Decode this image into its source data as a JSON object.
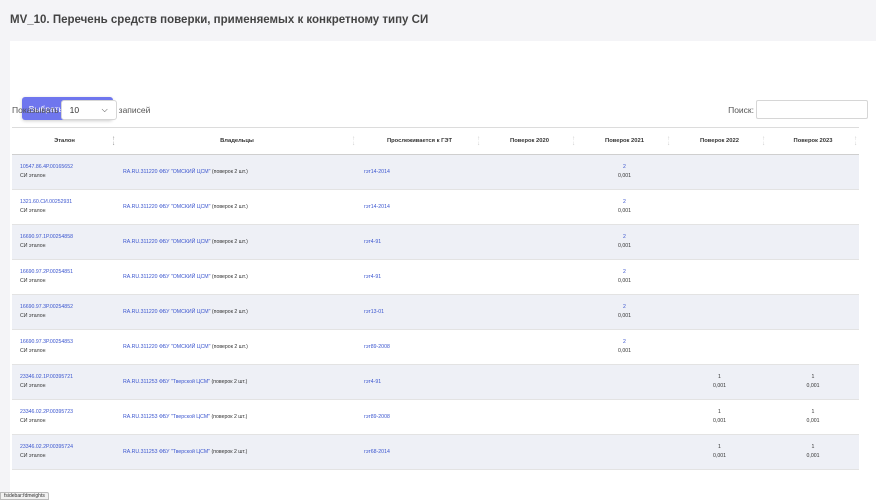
{
  "page": {
    "title": "MV_10. Перечень средств поверки, применяемых к конкретному типу СИ"
  },
  "toolbar": {
    "choose_label": "Выбрать другое СИ"
  },
  "length": {
    "prefix": "Показывать",
    "value": "10",
    "suffix": "записей"
  },
  "search": {
    "label": "Поиск:",
    "value": ""
  },
  "table": {
    "columns": [
      "Эталон",
      "Владельцы",
      "Прослеживается к ГЭТ",
      "Поверок 2020",
      "Поверок 2021",
      "Поверок 2022",
      "Поверок 2023"
    ],
    "rows": [
      {
        "etalon": "10547.86.4Р.00165652",
        "etalon_type": "СИ эталон",
        "owner_link": "RA.RU.311220 ФБУ \"ОМСКИЙ ЦСМ\"",
        "owner_count": "(поверок 2 шт.)",
        "get": "гэт14-2014",
        "p2020": "",
        "p2020b": "",
        "p2021": "2",
        "p2021b": "0,001",
        "p2022": "",
        "p2022b": "",
        "p2023": "",
        "p2023b": ""
      },
      {
        "etalon": "1321.60.СИ.00252931",
        "etalon_type": "СИ эталон",
        "owner_link": "RA.RU.311220 ФБУ \"ОМСКИЙ ЦСМ\"",
        "owner_count": "(поверок 2 шт.)",
        "get": "гэт14-2014",
        "p2020": "",
        "p2020b": "",
        "p2021": "2",
        "p2021b": "0,001",
        "p2022": "",
        "p2022b": "",
        "p2023": "",
        "p2023b": ""
      },
      {
        "etalon": "16690.97.1Р.00254858",
        "etalon_type": "СИ эталон",
        "owner_link": "RA.RU.311220 ФБУ \"ОМСКИЙ ЦСМ\"",
        "owner_count": "(поверок 2 шт.)",
        "get": "гэт4-91",
        "p2020": "",
        "p2020b": "",
        "p2021": "2",
        "p2021b": "0,001",
        "p2022": "",
        "p2022b": "",
        "p2023": "",
        "p2023b": ""
      },
      {
        "etalon": "16690.97.2Р.00254851",
        "etalon_type": "СИ эталон",
        "owner_link": "RA.RU.311220 ФБУ \"ОМСКИЙ ЦСМ\"",
        "owner_count": "(поверок 2 шт.)",
        "get": "гэт4-91",
        "p2020": "",
        "p2020b": "",
        "p2021": "2",
        "p2021b": "0,001",
        "p2022": "",
        "p2022b": "",
        "p2023": "",
        "p2023b": ""
      },
      {
        "etalon": "16690.97.3Р.00254852",
        "etalon_type": "СИ эталон",
        "owner_link": "RA.RU.311220 ФБУ \"ОМСКИЙ ЦСМ\"",
        "owner_count": "(поверок 2 шт.)",
        "get": "гэт13-01",
        "p2020": "",
        "p2020b": "",
        "p2021": "2",
        "p2021b": "0,001",
        "p2022": "",
        "p2022b": "",
        "p2023": "",
        "p2023b": ""
      },
      {
        "etalon": "16690.97.3Р.00254853",
        "etalon_type": "СИ эталон",
        "owner_link": "RA.RU.311220 ФБУ \"ОМСКИЙ ЦСМ\"",
        "owner_count": "(поверок 2 шт.)",
        "get": "гэт89-2008",
        "p2020": "",
        "p2020b": "",
        "p2021": "2",
        "p2021b": "0,001",
        "p2022": "",
        "p2022b": "",
        "p2023": "",
        "p2023b": ""
      },
      {
        "etalon": "23346.02.1Р.00395721",
        "etalon_type": "СИ эталон",
        "owner_link": "RA.RU.311253 ФБУ \"Тверской ЦСМ\"",
        "owner_count": "(поверок 2 шт.)",
        "get": "гэт4-91",
        "p2020": "",
        "p2020b": "",
        "p2021": "",
        "p2021b": "",
        "p2022": "1",
        "p2022b": "0,001",
        "p2023": "1",
        "p2023b": "0,001"
      },
      {
        "etalon": "23346.02.2Р.00395723",
        "etalon_type": "СИ эталон",
        "owner_link": "RA.RU.311253 ФБУ \"Тверской ЦСМ\"",
        "owner_count": "(поверок 2 шт.)",
        "get": "гэт89-2008",
        "p2020": "",
        "p2020b": "",
        "p2021": "",
        "p2021b": "",
        "p2022": "1",
        "p2022b": "0,001",
        "p2023": "1",
        "p2023b": "0,001"
      },
      {
        "etalon": "23346.02.2Р.00395724",
        "etalon_type": "СИ эталон",
        "owner_link": "RA.RU.311253 ФБУ \"Тверской ЦСМ\"",
        "owner_count": "(поверок 2 шт.)",
        "get": "гэт68-2014",
        "p2020": "",
        "p2020b": "",
        "p2021": "",
        "p2021b": "",
        "p2022": "1",
        "p2022b": "0,001",
        "p2023": "1",
        "p2023b": "0,001"
      }
    ]
  },
  "status": {
    "text": "fsidebar:fdmeights"
  },
  "colors": {
    "accent": "#6f76ee",
    "link": "#3a55cf",
    "row_alt": "#eef0f6"
  }
}
